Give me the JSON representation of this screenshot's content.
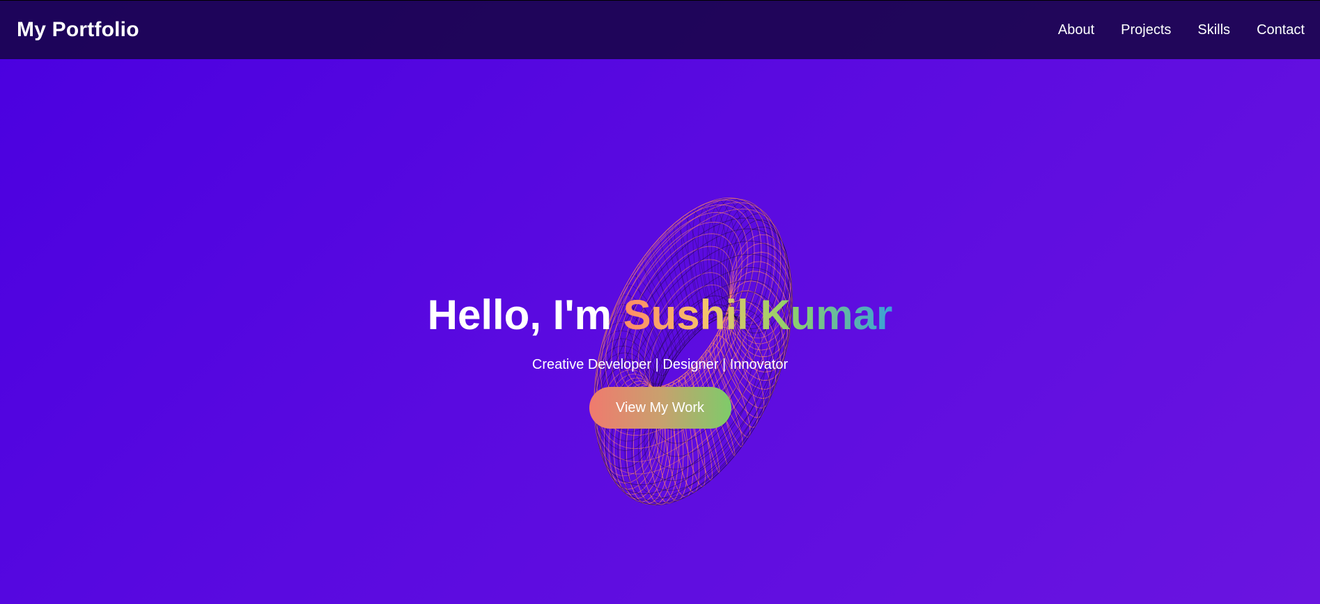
{
  "nav": {
    "brand": "My Portfolio",
    "links": [
      "About",
      "Projects",
      "Skills",
      "Contact"
    ]
  },
  "hero": {
    "greeting": "Hello, I'm ",
    "name": "Sushil Kumar",
    "subtitle": "Creative Developer | Designer | Innovator",
    "cta_label": "View My Work"
  },
  "colors": {
    "background": "#4a00e0",
    "navbar": "#1a0650",
    "accent_gradient": [
      "#ff8a65",
      "#f6c36b",
      "#8fd16a",
      "#3aa0d8"
    ],
    "torus_wire": "#ff8a65"
  }
}
